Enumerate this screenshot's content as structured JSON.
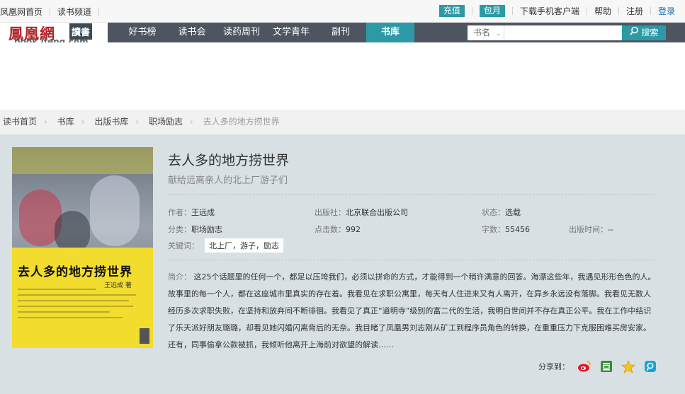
{
  "topbar": {
    "left_links": [
      "凤凰网首页",
      "读书频道"
    ],
    "recharge": "充值",
    "monthly": "包月",
    "right_links": [
      "下载手机客户端",
      "帮助",
      "注册"
    ],
    "login": "登录"
  },
  "logo": {
    "cn": "鳳凰網",
    "dushu": "讀書",
    "domain": "book.ifeng.com"
  },
  "nav": {
    "items": [
      "好书榜",
      "读书会",
      "读药周刊",
      "文学青年",
      "副刊",
      "书库"
    ],
    "search_select": "书名",
    "search_button": "搜索"
  },
  "breadcrumb": [
    "读书首页",
    "书库",
    "出版书库",
    "职场励志"
  ],
  "breadcrumb_current": "去人多的地方捞世界",
  "book": {
    "title": "去人多的地方捞世界",
    "subtitle": "献给远离亲人的北上厂游子们",
    "author_label": "作者：",
    "author": "王远成",
    "publisher_label": "出版社：",
    "publisher": "北京联合出版公司",
    "status_label": "状态：",
    "status": "选载",
    "category_label": "分类：",
    "category": "职场励志",
    "clicks_label": "点击数：",
    "clicks": "992",
    "words_label": "字数：",
    "words": "55456",
    "pubtime_label": "出版时间：",
    "pubtime": "--",
    "keywords_label": "关键词：",
    "keywords": "北上厂，游子，励志",
    "desc_label": "简介：",
    "desc": "这25个话题里的任何一个，都足以压垮我们，必须以拼命的方式，才能得到一个稍许满意的回答。海漂这些年，我遇见形形色色的人。故事里的每一个人，都在这座城市里真实的存在着。我看见在求职公寓里，每天有人住进来又有人离开，在异乡永远没有落脚。我看见无数人经历多次求职失败，在坚持和放弃间不断徘徊。我看见了真正“道明寺”级别的富二代的生活，我明白世间并不存在真正公平。我在工作中结识了乐天派好朋友璐璐，却看见她闪婚闪离背后的无奈。我目睹了凤凰男刘志刚从矿工到程序员角色的转换，在重重压力下克服困难买房安家。还有，同事偷拿公款被抓，我倾听他离开上海前对欲望的解读……"
  },
  "cover": {
    "title": "去人多的地方捞世界",
    "author": "王远成 著"
  },
  "share": {
    "label": "分享到：",
    "icons": [
      "weibo-icon",
      "douban-icon",
      "qzone-icon",
      "other-share-icon"
    ]
  },
  "colors": {
    "accent": "#2b9aa6",
    "nav": "#4d5561",
    "panel": "#d8e0e4",
    "brand_red": "#b3272b"
  }
}
